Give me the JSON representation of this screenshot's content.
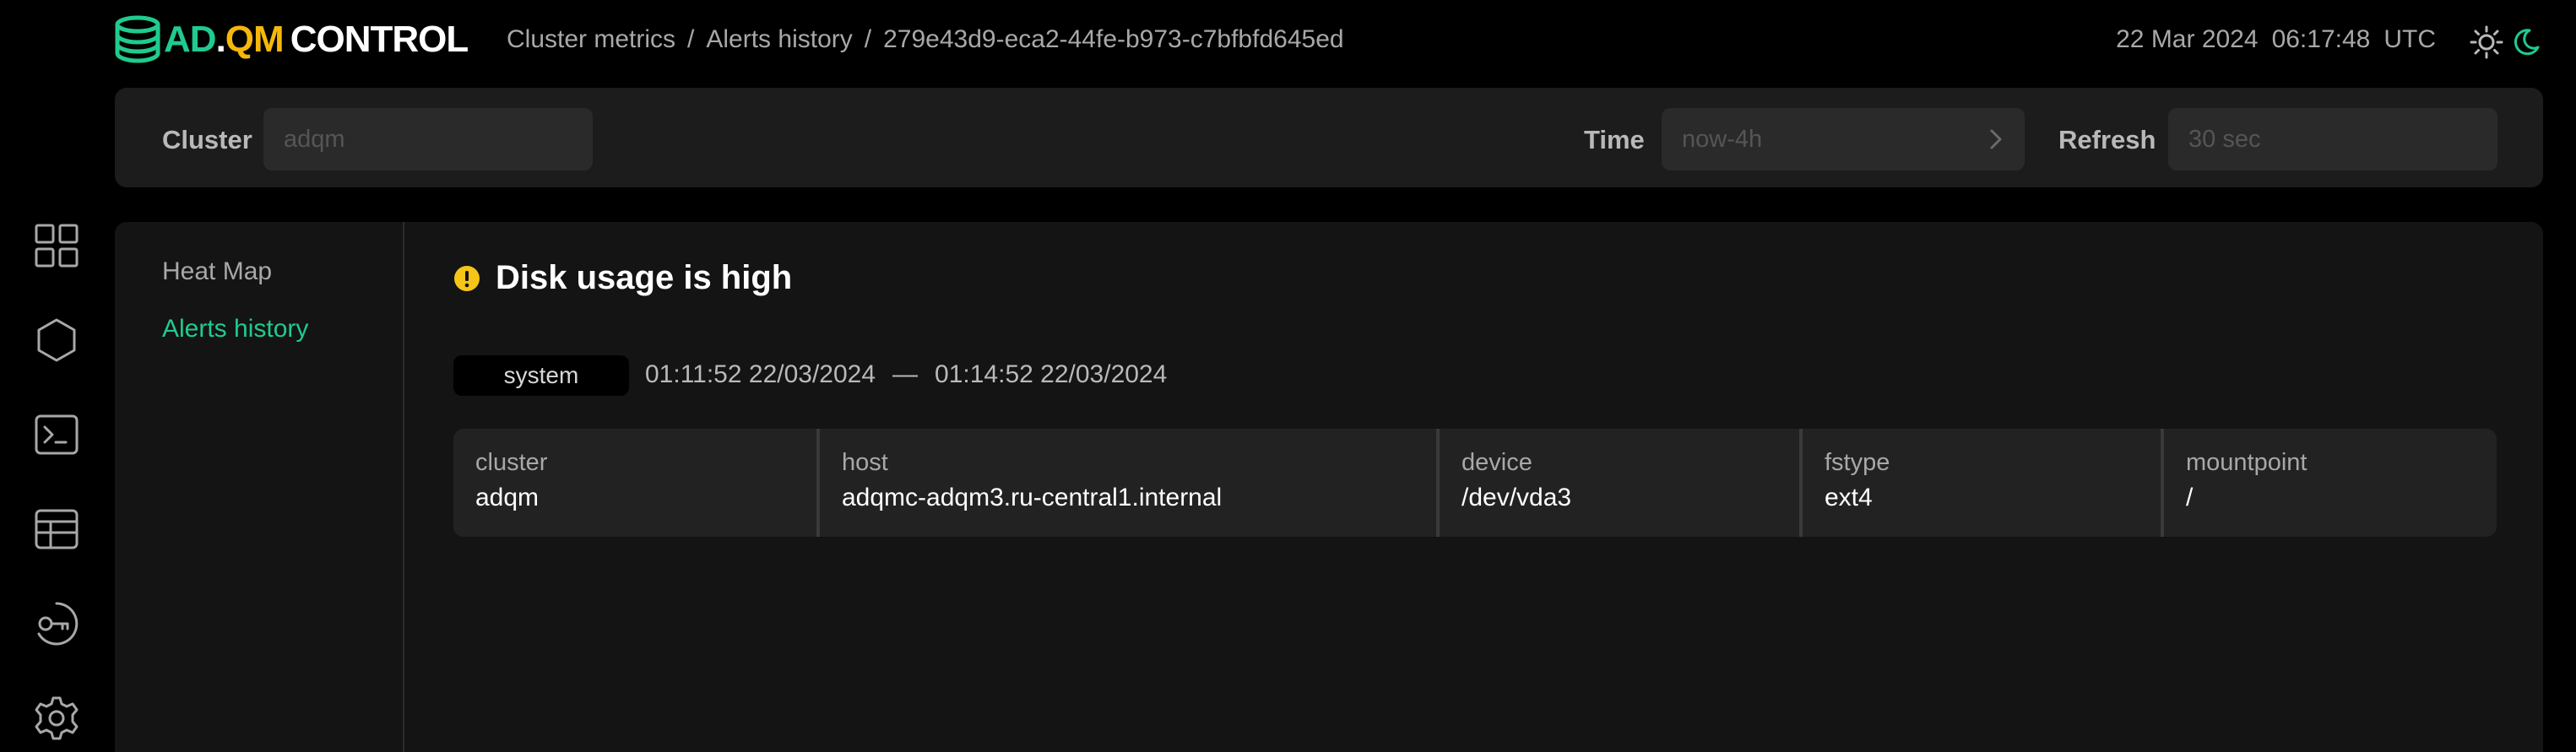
{
  "logo": {
    "ad": "AD",
    "dot": ".",
    "qm": "QM",
    "control": "CONTROL"
  },
  "breadcrumb": [
    {
      "label": "Cluster metrics"
    },
    {
      "label": "Alerts history"
    },
    {
      "label": "279e43d9-eca2-44fe-b973-c7bfbfd645ed"
    }
  ],
  "breadcrumb_separator": "/",
  "header": {
    "date": "22 Mar 2024",
    "time": "06:17:48",
    "timezone": "UTC"
  },
  "filters": {
    "cluster": {
      "label": "Cluster",
      "placeholder": "adqm"
    },
    "time": {
      "label": "Time",
      "placeholder": "now-4h"
    },
    "refresh": {
      "label": "Refresh",
      "placeholder": "30 sec"
    }
  },
  "sidebar_icons": [
    "dashboard-grid-icon",
    "hexagon-icon",
    "terminal-icon",
    "table-icon",
    "key-icon",
    "settings-gear-icon"
  ],
  "subnav": {
    "items": [
      {
        "label": "Heat Map",
        "active": false
      },
      {
        "label": "Alerts history",
        "active": true
      }
    ]
  },
  "alert": {
    "title": "Disk usage is high",
    "severity_icon": "warning-icon",
    "tag": "system",
    "start": "01:11:52 22/03/2024",
    "dash": "—",
    "end": "01:14:52 22/03/2024",
    "labels": [
      {
        "key": "cluster",
        "value": "adqm"
      },
      {
        "key": "host",
        "value": "adqmc-adqm3.ru-central1.internal"
      },
      {
        "key": "device",
        "value": "/dev/vda3"
      },
      {
        "key": "fstype",
        "value": "ext4"
      },
      {
        "key": "mountpoint",
        "value": "/"
      }
    ]
  },
  "colors": {
    "accent": "#1fcb8e",
    "brand_yellow": "#f5b70a",
    "warning": "#f5c518",
    "background": "#000000",
    "panel": "#141414"
  }
}
